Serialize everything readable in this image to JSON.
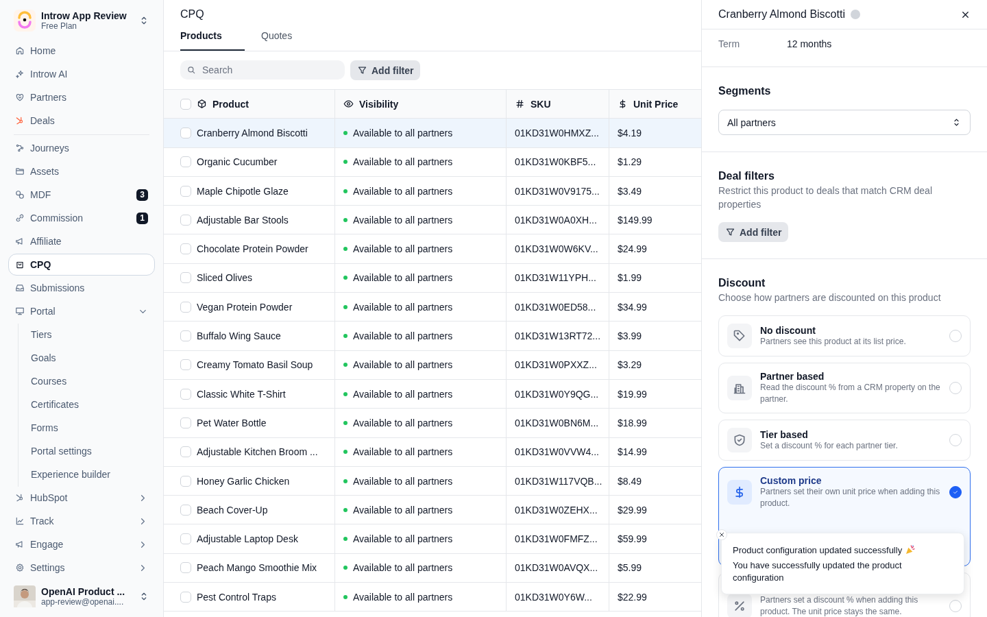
{
  "sidebar": {
    "workspace": {
      "name": "Introw App Review",
      "plan": "Free Plan"
    },
    "groups": [
      {
        "items": [
          {
            "label": "Home",
            "selected": false
          },
          {
            "label": "Introw AI",
            "selected": false
          },
          {
            "label": "Partners",
            "selected": false
          },
          {
            "label": "Deals",
            "selected": false
          }
        ]
      },
      {
        "items": [
          {
            "label": "Journeys",
            "selected": false
          },
          {
            "label": "Assets",
            "selected": false
          },
          {
            "label": "MDF",
            "selected": false,
            "badge": "3"
          },
          {
            "label": "Commission",
            "selected": false,
            "badge": "1"
          },
          {
            "label": "Affiliate",
            "selected": false
          },
          {
            "label": "CPQ",
            "selected": true
          },
          {
            "label": "Submissions",
            "selected": false
          },
          {
            "label": "Portal",
            "selected": false,
            "expanded": true,
            "children": [
              {
                "label": "Tiers",
                "selected": false
              },
              {
                "label": "Goals",
                "selected": false
              },
              {
                "label": "Courses",
                "selected": false
              },
              {
                "label": "Certificates",
                "selected": false
              },
              {
                "label": "Forms",
                "selected": false
              },
              {
                "label": "Portal settings",
                "selected": false
              },
              {
                "label": "Experience builder",
                "selected": false
              }
            ]
          },
          {
            "label": "HubSpot",
            "selected": false,
            "expanded": false
          },
          {
            "label": "Track",
            "selected": false,
            "expanded": false
          },
          {
            "label": "Engage",
            "selected": false,
            "expanded": false
          },
          {
            "label": "Settings",
            "selected": false,
            "expanded": false
          }
        ]
      }
    ],
    "user": {
      "name": "OpenAI Product ...",
      "email": "app-review@openai...."
    }
  },
  "main": {
    "title": "CPQ",
    "tabs": [
      {
        "label": "Products",
        "selected": true
      },
      {
        "label": "Quotes",
        "selected": false
      }
    ],
    "search": {
      "placeholder": "Search"
    },
    "filter_button": "Add filter",
    "table": {
      "select_all": {
        "checked": false
      },
      "columns": [
        "Product",
        "Visibility",
        "SKU",
        "Unit Price"
      ],
      "rows": [
        {
          "product": "Cranberry Almond Biscotti",
          "visibility": "Available to all partners",
          "sku": "01KD31W0HMXZ...",
          "price": "$4.19",
          "selected": true,
          "checked": false
        },
        {
          "product": "Organic Cucumber",
          "visibility": "Available to all partners",
          "sku": "01KD31W0KBF5...",
          "price": "$1.29",
          "selected": false,
          "checked": false
        },
        {
          "product": "Maple Chipotle Glaze",
          "visibility": "Available to all partners",
          "sku": "01KD31W0V9175...",
          "price": "$3.49",
          "selected": false,
          "checked": false
        },
        {
          "product": "Adjustable Bar Stools",
          "visibility": "Available to all partners",
          "sku": "01KD31W0A0XH...",
          "price": "$149.99",
          "selected": false,
          "checked": false
        },
        {
          "product": "Chocolate Protein Powder",
          "visibility": "Available to all partners",
          "sku": "01KD31W0W6KV...",
          "price": "$24.99",
          "selected": false,
          "checked": false
        },
        {
          "product": "Sliced Olives",
          "visibility": "Available to all partners",
          "sku": "01KD31W11YPH...",
          "price": "$1.99",
          "selected": false,
          "checked": false
        },
        {
          "product": "Vegan Protein Powder",
          "visibility": "Available to all partners",
          "sku": "01KD31W0ED58...",
          "price": "$34.99",
          "selected": false,
          "checked": false
        },
        {
          "product": "Buffalo Wing Sauce",
          "visibility": "Available to all partners",
          "sku": "01KD31W13RT72...",
          "price": "$3.99",
          "selected": false,
          "checked": false
        },
        {
          "product": "Creamy Tomato Basil Soup",
          "visibility": "Available to all partners",
          "sku": "01KD31W0PXXZ...",
          "price": "$3.29",
          "selected": false,
          "checked": false
        },
        {
          "product": "Classic White T-Shirt",
          "visibility": "Available to all partners",
          "sku": "01KD31W0Y9QG...",
          "price": "$19.99",
          "selected": false,
          "checked": false
        },
        {
          "product": "Pet Water Bottle",
          "visibility": "Available to all partners",
          "sku": "01KD31W0BN6M...",
          "price": "$18.99",
          "selected": false,
          "checked": false
        },
        {
          "product": "Adjustable Kitchen Broom ...",
          "visibility": "Available to all partners",
          "sku": "01KD31W0VVW4...",
          "price": "$14.99",
          "selected": false,
          "checked": false
        },
        {
          "product": "Honey Garlic Chicken",
          "visibility": "Available to all partners",
          "sku": "01KD31W117VQB...",
          "price": "$8.49",
          "selected": false,
          "checked": false
        },
        {
          "product": "Beach Cover-Up",
          "visibility": "Available to all partners",
          "sku": "01KD31W0ZEHX...",
          "price": "$29.99",
          "selected": false,
          "checked": false
        },
        {
          "product": "Adjustable Laptop Desk",
          "visibility": "Available to all partners",
          "sku": "01KD31W0FMFZ...",
          "price": "$59.99",
          "selected": false,
          "checked": false
        },
        {
          "product": "Peach Mango Smoothie Mix",
          "visibility": "Available to all partners",
          "sku": "01KD31W0AVQX...",
          "price": "$5.99",
          "selected": false,
          "checked": false
        },
        {
          "product": "Pest Control Traps",
          "visibility": "Available to all partners",
          "sku": "01KD31W0Y6W...",
          "price": "$22.99",
          "selected": false,
          "checked": false
        }
      ]
    }
  },
  "panel": {
    "title": "Cranberry Almond Biscotti",
    "fields": [
      {
        "label": "Term",
        "value": "12 months"
      }
    ],
    "segments": {
      "heading": "Segments",
      "value": "All partners"
    },
    "deal_filters": {
      "heading": "Deal filters",
      "description": "Restrict this product to deals that match CRM deal properties",
      "button": "Add filter"
    },
    "discount": {
      "heading": "Discount",
      "description": "Choose how partners are discounted on this product",
      "options": [
        {
          "title": "No discount",
          "description": "Partners see this product at its list price.",
          "selected": false
        },
        {
          "title": "Partner based",
          "description": "Read the discount % from a CRM property on the partner.",
          "selected": false
        },
        {
          "title": "Tier based",
          "description": "Set a discount % for each partner tier.",
          "selected": false
        },
        {
          "title": "Custom price",
          "description": "Partners set their own unit price when adding this product.",
          "selected": true
        },
        {
          "description": "Partners set a discount % when adding this product. The unit price stays the same.",
          "selected": false
        }
      ]
    },
    "toast": {
      "title": "Product configuration updated successfully",
      "message": "You have successfully updated the product configuration"
    }
  }
}
